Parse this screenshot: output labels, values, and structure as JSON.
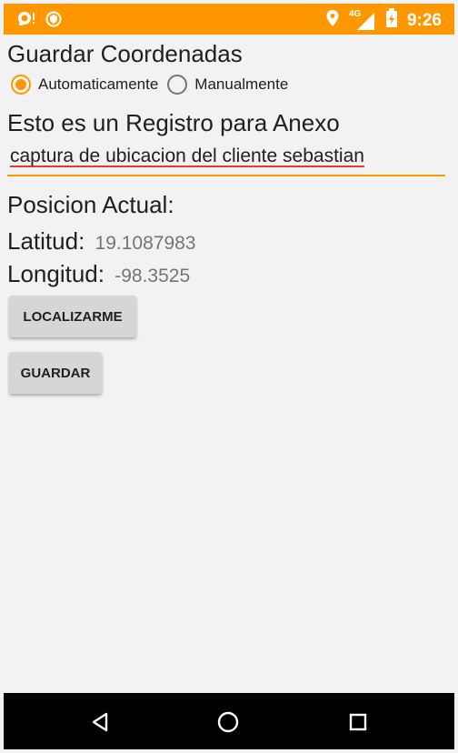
{
  "status_bar": {
    "time": "9:26",
    "network": "4G",
    "icons": [
      "notification-search-icon",
      "shield-icon",
      "location-icon",
      "signal-icon",
      "battery-icon"
    ]
  },
  "form": {
    "title": "Guardar Coordenadas",
    "radio_options": [
      {
        "label": "Automaticamente",
        "checked": true
      },
      {
        "label": "Manualmente",
        "checked": false
      }
    ],
    "registro_label": "Esto es un Registro para Anexo",
    "note_value": "captura de ubicacion del cliente sebastian",
    "position_heading": "Posicion Actual:",
    "latitude_label": "Latitud:",
    "latitude_value": "19.1087983",
    "longitude_label": "Longitud:",
    "longitude_value": "-98.3525",
    "locate_button": "LOCALIZARME",
    "save_button": "GUARDAR"
  },
  "navigation": {
    "icons": [
      "back-icon",
      "home-icon",
      "recents-icon"
    ]
  },
  "colors": {
    "accent": "#ff9800",
    "spellcheck": "#e53935",
    "background": "#f2f2f2"
  }
}
